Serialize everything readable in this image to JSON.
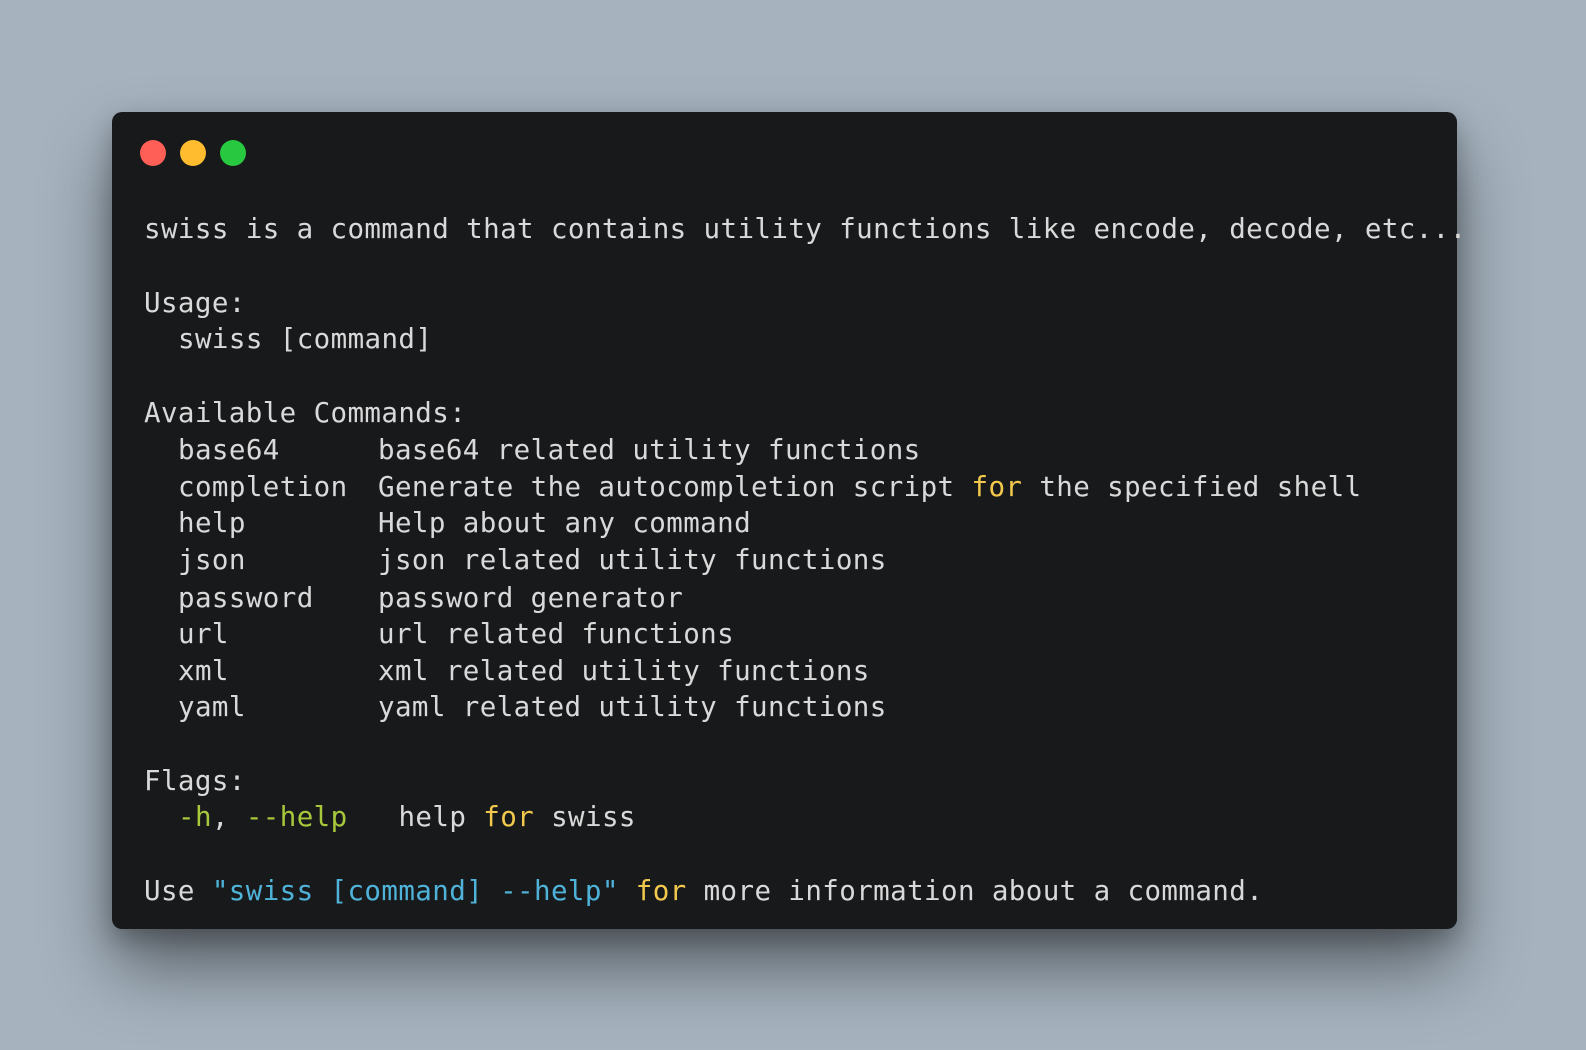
{
  "window": {
    "controls": [
      "close",
      "minimize",
      "maximize"
    ],
    "colors": {
      "close": "#ff5f57",
      "minimize": "#febc2e",
      "maximize": "#28c840"
    }
  },
  "output": {
    "description": "swiss is a command that contains utility functions like encode, decode, etc...",
    "usage_header": "Usage:",
    "usage_line": "swiss [command]",
    "commands_header": "Available Commands:",
    "commands": [
      {
        "name": "base64",
        "desc": "base64 related utility functions"
      },
      {
        "name": "completion",
        "desc_before": "Generate the autocompletion script ",
        "desc_keyword": "for",
        "desc_after": " the specified shell"
      },
      {
        "name": "help",
        "desc": "Help about any command"
      },
      {
        "name": "json",
        "desc": "json related utility functions"
      },
      {
        "name": "password",
        "desc": "password generator"
      },
      {
        "name": "url",
        "desc": "url related functions"
      },
      {
        "name": "xml",
        "desc": "xml related utility functions"
      },
      {
        "name": "yaml",
        "desc": "yaml related utility functions"
      }
    ],
    "flags_header": "Flags:",
    "flag": {
      "short": "-h",
      "sep": ", ",
      "long": "--help",
      "desc_before": "help ",
      "desc_keyword": "for",
      "desc_after": " swiss"
    },
    "footer": {
      "prefix": "Use ",
      "quoted": "\"swiss [command] --help\"",
      "keyword": "for",
      "suffix": " more information about a command."
    }
  },
  "colors": {
    "background": "#a6b3bf",
    "terminal": "#18191b",
    "text": "#d9d9d9",
    "keyword": "#f2c94c",
    "flag": "#a8c83c",
    "string": "#4fb3d9"
  }
}
